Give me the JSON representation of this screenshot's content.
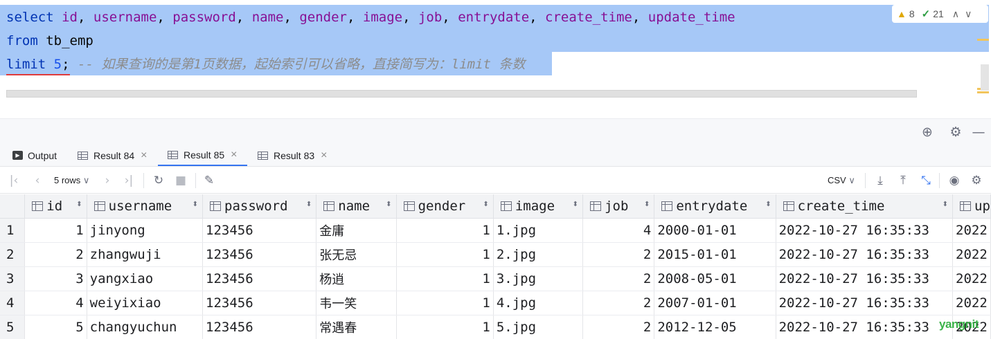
{
  "editor": {
    "line1": {
      "select": "select",
      "cols": [
        "id",
        "username",
        "password",
        "name",
        "gender",
        "image",
        "job",
        "entrydate",
        "create_time",
        "update_time"
      ]
    },
    "line2": {
      "from": "from",
      "table": "tb_emp"
    },
    "line3": {
      "limit": "limit",
      "count": "5",
      "semicolon": ";",
      "comment": "-- 如果查询的是第1页数据，起始索引可以省略，直接简写为：limit 条数"
    },
    "inspection": {
      "warnings": "8",
      "weak_warnings": "21"
    }
  },
  "tabs": [
    {
      "label": "Output",
      "icon": "output-icon",
      "active": false
    },
    {
      "label": "Result 84",
      "icon": "table-icon",
      "active": false
    },
    {
      "label": "Result 85",
      "icon": "table-icon",
      "active": true
    },
    {
      "label": "Result 83",
      "icon": "table-icon",
      "active": false
    }
  ],
  "toolbar": {
    "rows": "5 rows",
    "format": "CSV"
  },
  "grid": {
    "columns": [
      "id",
      "username",
      "password",
      "name",
      "gender",
      "image",
      "job",
      "entrydate",
      "create_time",
      "up"
    ],
    "rows": [
      [
        "1",
        "1",
        "jinyong",
        "123456",
        "金庸",
        "1",
        "1.jpg",
        "4",
        "2000-01-01",
        "2022-10-27 16:35:33",
        "2022"
      ],
      [
        "2",
        "2",
        "zhangwuji",
        "123456",
        "张无忌",
        "1",
        "2.jpg",
        "2",
        "2015-01-01",
        "2022-10-27 16:35:33",
        "2022"
      ],
      [
        "3",
        "3",
        "yangxiao",
        "123456",
        "杨逍",
        "1",
        "3.jpg",
        "2",
        "2008-05-01",
        "2022-10-27 16:35:33",
        "2022"
      ],
      [
        "4",
        "4",
        "weiyixiao",
        "123456",
        "韦一笑",
        "1",
        "4.jpg",
        "2",
        "2007-01-01",
        "2022-10-27 16:35:33",
        "2022"
      ],
      [
        "5",
        "5",
        "changyuchun",
        "123456",
        "常遇春",
        "1",
        "5.jpg",
        "2",
        "2012-12-05",
        "2022-10-27 16:35:33",
        "2022"
      ]
    ]
  },
  "watermark": "yangnit",
  "colors": {
    "selection": "#a6c8f7",
    "keyword": "#0033b3",
    "identifier": "#871094",
    "accent": "#3574f0"
  }
}
